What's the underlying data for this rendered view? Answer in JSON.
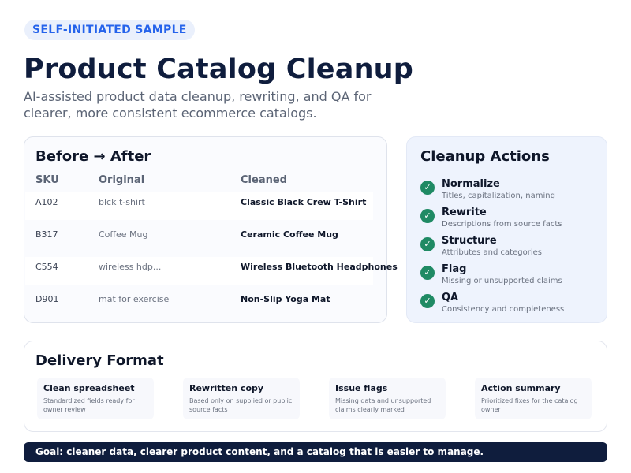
{
  "badge": "SELF-INITIATED SAMPLE",
  "title": "Product Catalog Cleanup",
  "subtitle": "AI-assisted product data cleanup, rewriting, and QA for clearer, more consistent ecommerce catalogs.",
  "before_after": {
    "title": "Before → After",
    "headers": {
      "sku": "SKU",
      "original": "Original",
      "cleaned": "Cleaned"
    },
    "rows": [
      {
        "sku": "A102",
        "original": "blck t-shirt",
        "cleaned": "Classic Black Crew T-Shirt"
      },
      {
        "sku": "B317",
        "original": "Coffee Mug",
        "cleaned": "Ceramic Coffee Mug"
      },
      {
        "sku": "C554",
        "original": "wireless hdp...",
        "cleaned": "Wireless Bluetooth Headphones"
      },
      {
        "sku": "D901",
        "original": "mat for exercise",
        "cleaned": "Non-Slip Yoga Mat"
      }
    ]
  },
  "actions": {
    "title": "Cleanup Actions",
    "check_icon": "check-circle-icon",
    "check_color": "#1f8a64",
    "items": [
      {
        "title": "Normalize",
        "desc": "Titles, capitalization, naming"
      },
      {
        "title": "Rewrite",
        "desc": "Descriptions from source facts"
      },
      {
        "title": "Structure",
        "desc": "Attributes and categories"
      },
      {
        "title": "Flag",
        "desc": "Missing or unsupported claims"
      },
      {
        "title": "QA",
        "desc": "Consistency and completeness"
      }
    ]
  },
  "delivery": {
    "title": "Delivery Format",
    "items": [
      {
        "title": "Clean spreadsheet",
        "desc": "Standardized fields ready for owner review"
      },
      {
        "title": "Rewritten copy",
        "desc": "Based only on supplied or public source facts"
      },
      {
        "title": "Issue flags",
        "desc": "Missing data and unsupported claims clearly marked"
      },
      {
        "title": "Action summary",
        "desc": "Prioritized fixes for the catalog owner"
      }
    ]
  },
  "goal": "Goal: cleaner data, clearer product content, and a catalog that is easier to manage.",
  "colors": {
    "accent": "#2563eb",
    "navy": "#0f1d3d",
    "success": "#1f8a64"
  }
}
